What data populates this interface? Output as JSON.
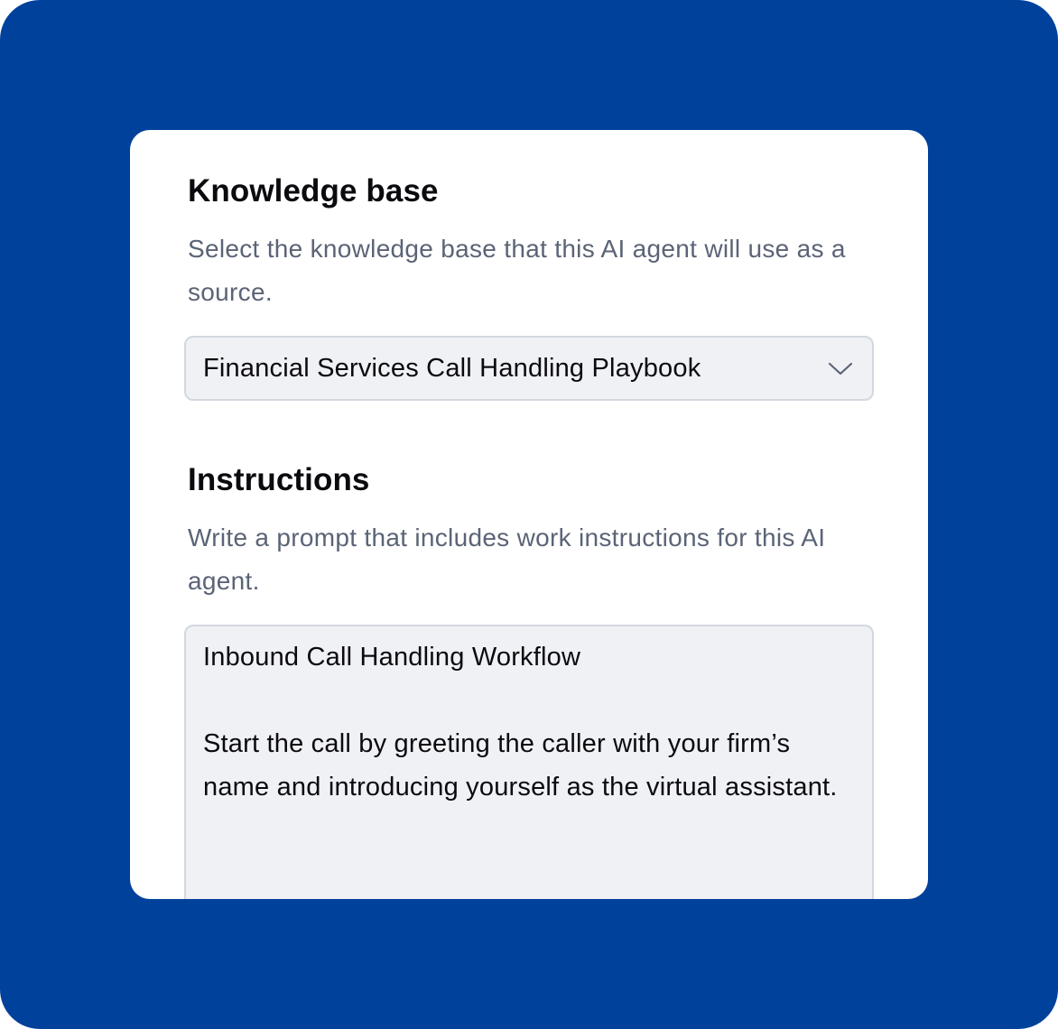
{
  "colors": {
    "background": "#00419c",
    "card": "#ffffff",
    "field_fill": "#f0f1f5",
    "field_border": "#d3d8e0",
    "heading_text": "#0b0b0f",
    "description_text": "#5b6476"
  },
  "knowledge_base": {
    "title": "Knowledge base",
    "description": "Select the knowledge base that this AI agent will use as a source.",
    "selected_value": "Financial Services Call Handling Playbook",
    "dropdown_icon": "chevron-down-icon"
  },
  "instructions": {
    "title": "Instructions",
    "description": "Write a prompt that includes work instructions for this AI agent.",
    "text_heading": "Inbound Call Handling Workflow",
    "text_body": "Start the call by greeting the caller with your firm’s name and introducing yourself as the virtual assistant."
  }
}
